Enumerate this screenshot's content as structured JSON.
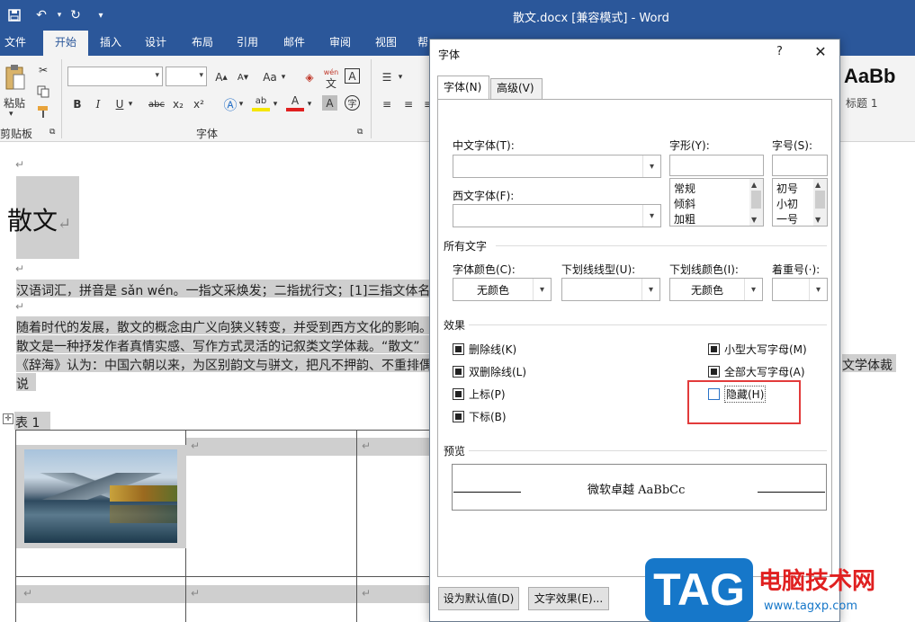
{
  "window": {
    "title": "散文.docx [兼容模式] - Word"
  },
  "quick_access": {
    "save_icon": "save-icon",
    "undo_icon": "undo-icon",
    "redo_icon": "redo-icon",
    "customize_icon": "customize-icon"
  },
  "tabs": [
    {
      "label": "文件"
    },
    {
      "label": "开始"
    },
    {
      "label": "插入"
    },
    {
      "label": "设计"
    },
    {
      "label": "布局"
    },
    {
      "label": "引用"
    },
    {
      "label": "邮件"
    },
    {
      "label": "审阅"
    },
    {
      "label": "视图"
    },
    {
      "label": "帮"
    }
  ],
  "ribbon": {
    "paste_label": "粘贴",
    "clipboard_group": "剪贴板",
    "font_group": "字体",
    "font_case": "Aa",
    "pinyin": "wén",
    "pinyin_char": "文",
    "border_char": "A",
    "bold": "B",
    "italic": "I",
    "underline": "U",
    "strike": "abc",
    "subscript": "x₂",
    "superscript": "x²",
    "highlight": "ab",
    "font_color": "A",
    "shade_char": "A",
    "circle_char": "字"
  },
  "styles_gallery": {
    "sample": "AaBb",
    "name": "标题 1"
  },
  "document": {
    "heading": "散文",
    "line1": "汉语词汇，拼音是 sǎn wén。一指文采焕发；二指扰行文；[1]三指文体名。",
    "line2": "随着时代的发展，散文的概念由广义向狭义转变，并受到西方文化的影响。",
    "line3": "散文是一种抒发作者真情实感、写作方式灵活的记叙类文学体裁。“散文”",
    "line4": "《辞海》认为：中国六朝以来，为区别韵文与骈文，把凡不押韵、不重排偶",
    "line4_tail": "文学体裁",
    "line5": "说",
    "table_caption": "表 1",
    "para_mark": "↵"
  },
  "dialog": {
    "title": "字体",
    "help": "?",
    "close": "✕",
    "tabs": [
      {
        "label": "字体(N)"
      },
      {
        "label": "高级(V)"
      }
    ],
    "chinese_font_label": "中文字体(T):",
    "western_font_label": "西文字体(F):",
    "style_label": "字形(Y):",
    "size_label": "字号(S):",
    "style_items": [
      "常规",
      "倾斜",
      "加粗"
    ],
    "size_items": [
      "初号",
      "小初",
      "一号"
    ],
    "all_text_group": "所有文字",
    "font_color_label": "字体颜色(C):",
    "font_color_value": "无颜色",
    "underline_type_label": "下划线线型(U):",
    "underline_color_label": "下划线颜色(I):",
    "underline_color_value": "无颜色",
    "emphasis_label": "着重号(·):",
    "effects_group": "效果",
    "effects_left": [
      "删除线(K)",
      "双删除线(L)",
      "上标(P)",
      "下标(B)"
    ],
    "effects_right": [
      "小型大写字母(M)",
      "全部大写字母(A)"
    ],
    "hidden_label": "隐藏(H)",
    "hidden_checked": false,
    "preview_group": "预览",
    "preview_text": "微软卓越  AaBbCc",
    "set_default_button": "设为默认值(D)",
    "text_effects_button": "文字效果(E)..."
  },
  "watermark": {
    "logo": "TAG",
    "site": "电脑技术网",
    "url": "www.tagxp.com"
  },
  "colors": {
    "word_blue": "#2b579a",
    "highlight_frame": "#e23b3b"
  }
}
